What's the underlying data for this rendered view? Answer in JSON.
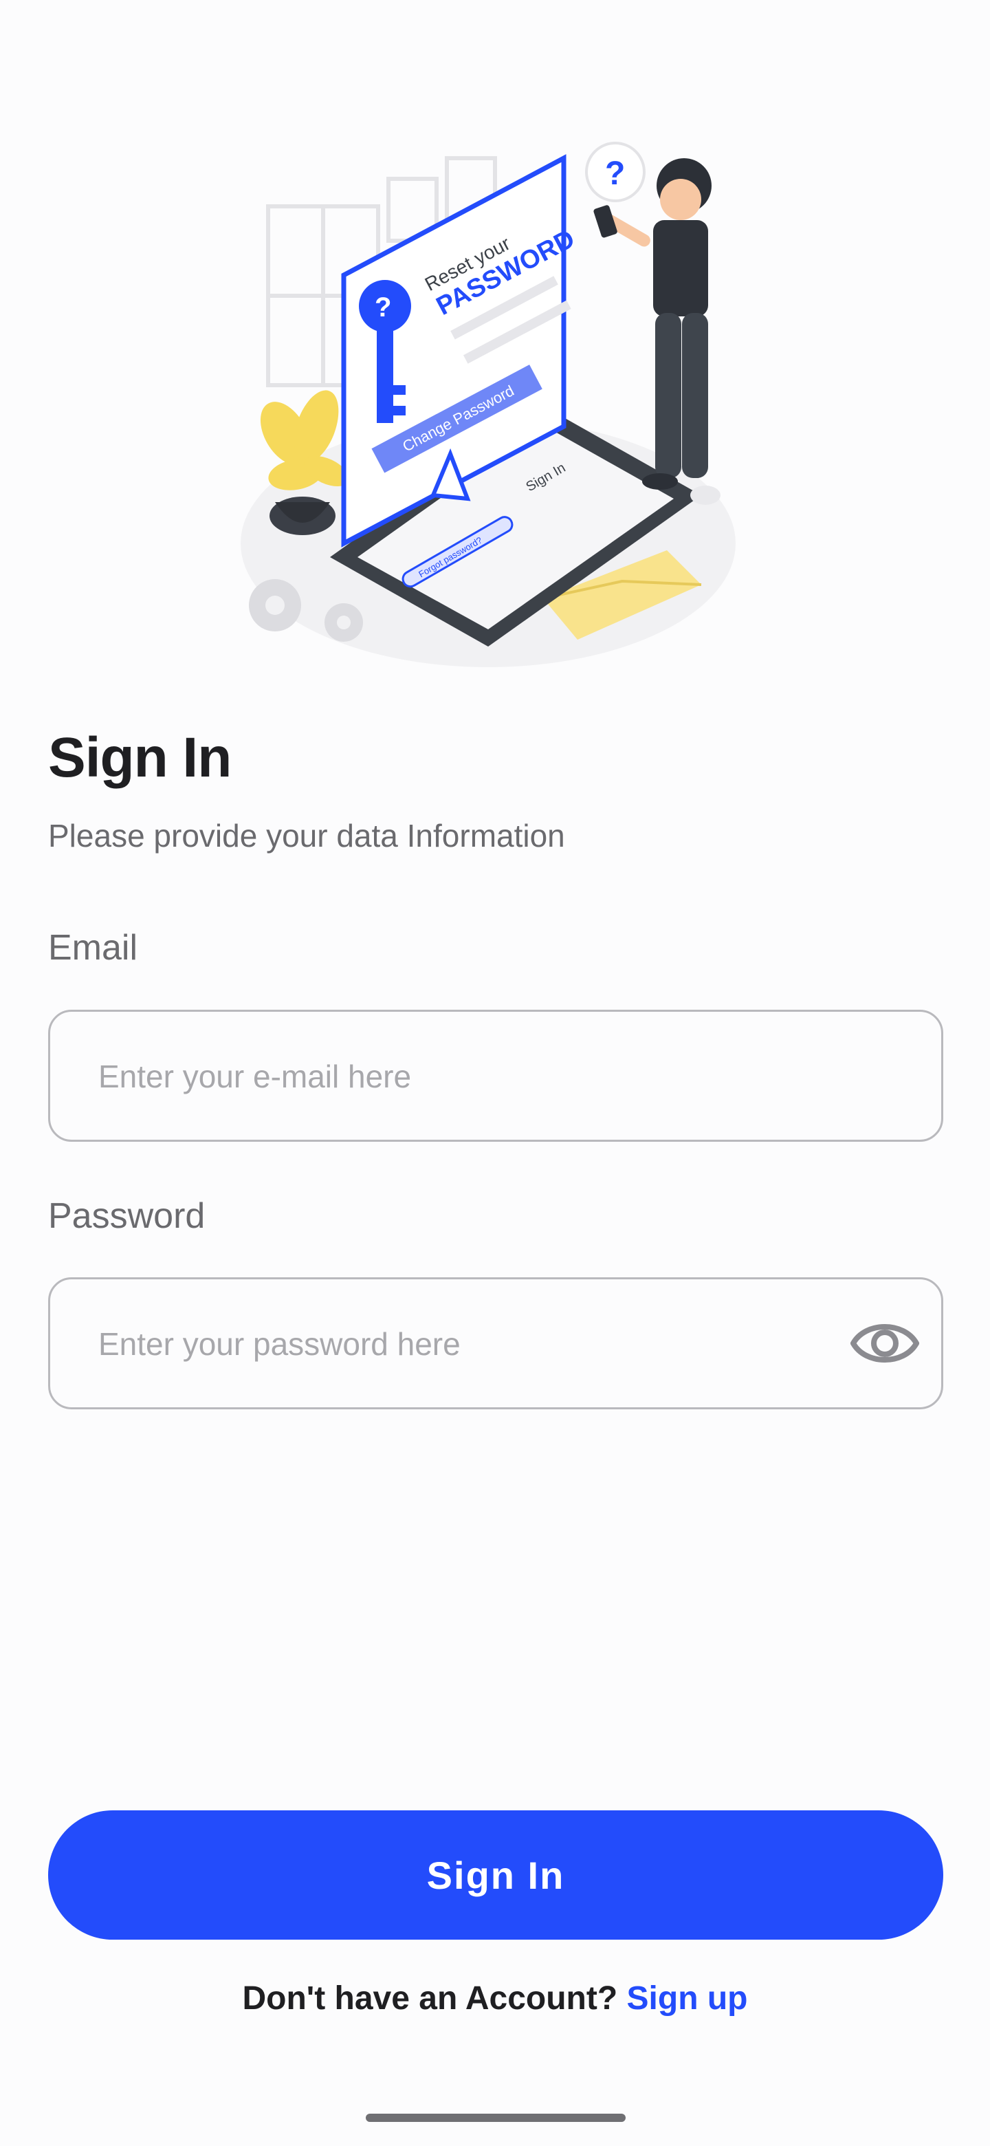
{
  "header": {
    "title": "Sign In",
    "subtitle": "Please provide your data Information"
  },
  "form": {
    "email_label": "Email",
    "email_placeholder": "Enter your e-mail here",
    "password_label": "Password",
    "password_placeholder": "Enter your password here",
    "password_toggle_icon": "eye-icon"
  },
  "actions": {
    "sign_in_label": "Sign In",
    "no_account_text": "Don't have an Account?",
    "sign_up_label": "Sign up"
  },
  "illustration": {
    "card_title_small": "Reset your",
    "card_title_big": "PASSWORD",
    "card_button": "Change Password",
    "phone_title": "Sign In",
    "phone_button": "Forgot password?"
  },
  "colors": {
    "accent": "#234cfb",
    "text": "#1f1f22",
    "muted": "#6a6a6e",
    "border": "#b9b9bd"
  }
}
